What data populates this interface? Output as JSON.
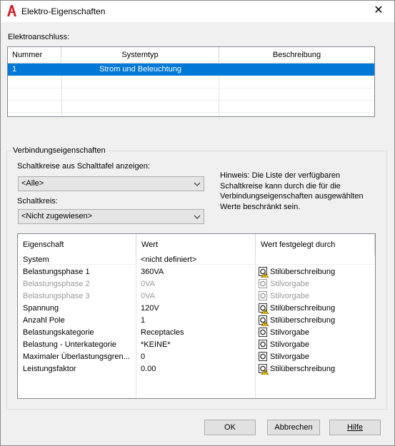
{
  "window": {
    "title": "Elektro-Eigenschaften"
  },
  "elektroanschluss": {
    "label": "Elektroanschluss:",
    "columns": [
      "Nummer",
      "Systemtyp",
      "Beschreibung"
    ],
    "rows": [
      {
        "nummer": "1",
        "systemtyp": "Strom und Beleuchtung",
        "beschreibung": ""
      }
    ]
  },
  "verbindung": {
    "group_title": "Verbindungseigenschaften",
    "schalttafel_label": "Schaltkreise aus Schalttafel anzeigen:",
    "schalttafel_value": "<Alle>",
    "schaltkreis_label": "Schaltkreis:",
    "schaltkreis_value": "<Nicht zugewiesen>",
    "hint": "Hinweis: Die Liste der verfügbaren Schaltkreise kann durch die für die Verbindungseigenschaften ausgewählten Werte beschränkt sein."
  },
  "properties": {
    "columns": [
      "Eigenschaft",
      "Wert",
      "Wert festgelegt durch"
    ],
    "rows": [
      {
        "name": "System",
        "value": "<nicht definiert>",
        "source": "",
        "icon": "",
        "disabled": false
      },
      {
        "name": "Belastungsphase 1",
        "value": "360VA",
        "source": "Stilüberschreibung",
        "icon": "style-override-icon",
        "disabled": false
      },
      {
        "name": "Belastungsphase 2",
        "value": "0VA",
        "source": "Stilvorgabe",
        "icon": "style-default-icon",
        "disabled": true
      },
      {
        "name": "Belastungsphase 3",
        "value": "0VA",
        "source": "Stilvorgabe",
        "icon": "style-default-icon",
        "disabled": true
      },
      {
        "name": "Spannung",
        "value": "120V",
        "source": "Stilüberschreibung",
        "icon": "style-override-icon",
        "disabled": false
      },
      {
        "name": "Anzahl Pole",
        "value": "1",
        "source": "Stilüberschreibung",
        "icon": "style-override-icon",
        "disabled": false
      },
      {
        "name": "Belastungskategorie",
        "value": "Receptacles",
        "source": "Stilvorgabe",
        "icon": "style-default-icon",
        "disabled": false
      },
      {
        "name": "Belastung - Unterkategorie",
        "value": "*KEINE*",
        "source": "Stilvorgabe",
        "icon": "style-default-icon",
        "disabled": false
      },
      {
        "name": "Maximaler Überlastungsgren...",
        "value": "0",
        "source": "Stilvorgabe",
        "icon": "style-default-icon",
        "disabled": false
      },
      {
        "name": "Leistungsfaktor",
        "value": "0.00",
        "source": "Stilüberschreibung",
        "icon": "style-override-icon",
        "disabled": false
      }
    ]
  },
  "buttons": {
    "ok": "OK",
    "cancel": "Abbrechen",
    "help": "Hilfe"
  },
  "colors": {
    "selection": "#0078d7",
    "brand": "#d21f26"
  }
}
